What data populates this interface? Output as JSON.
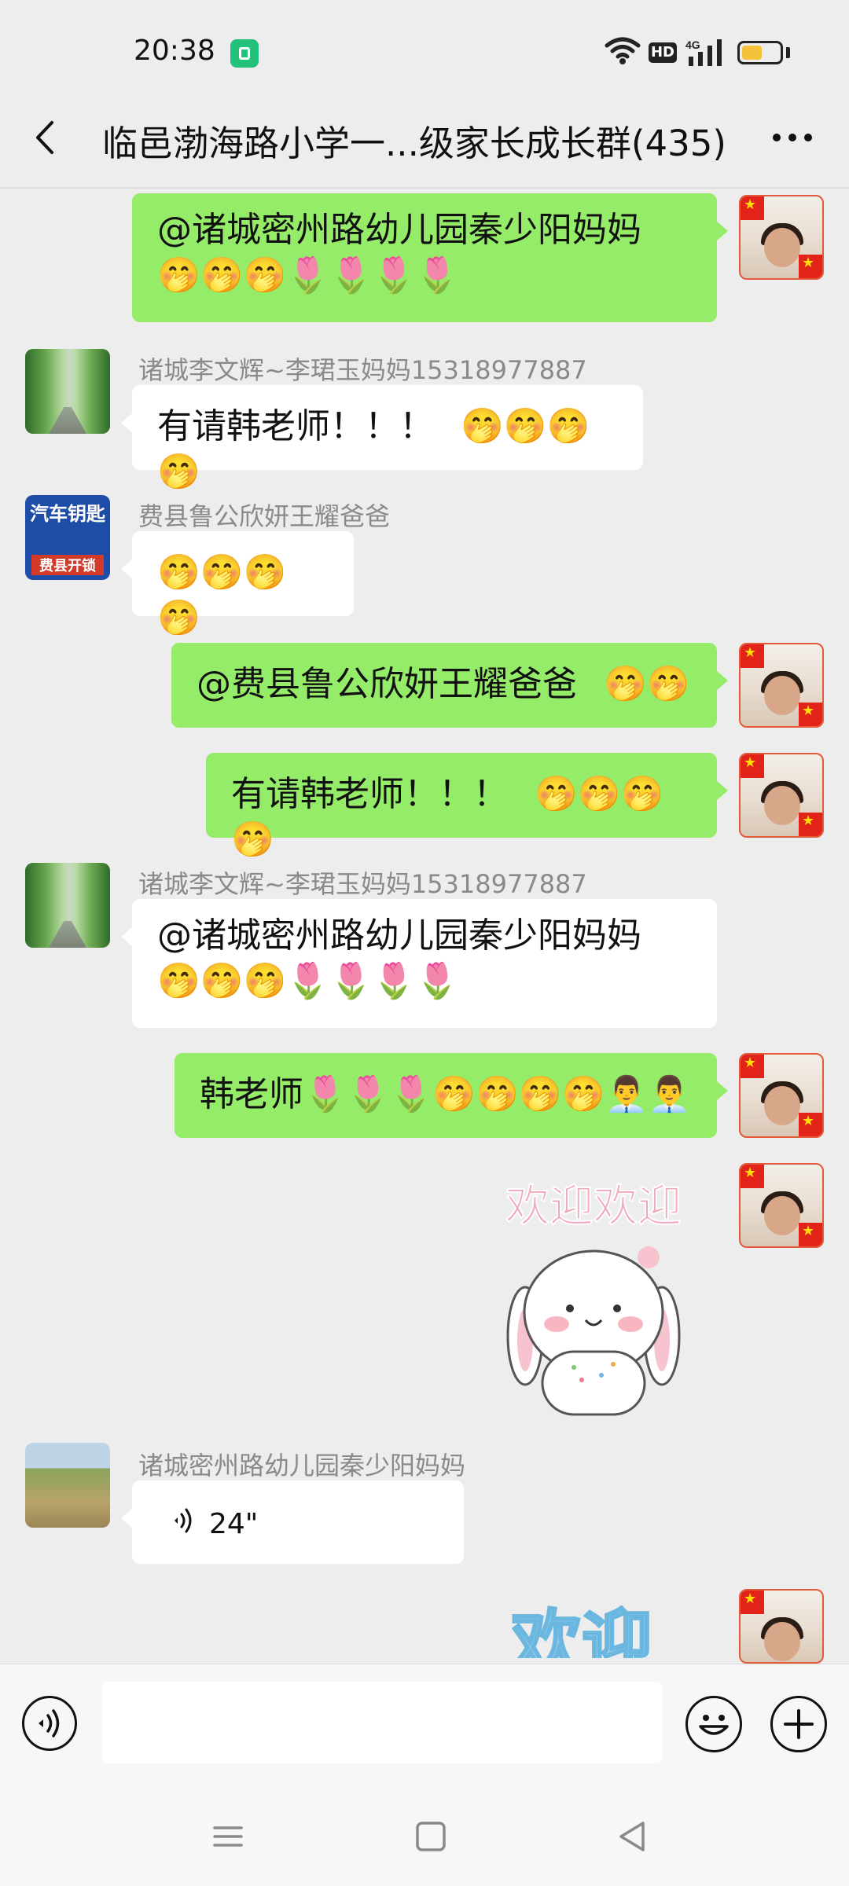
{
  "status_bar": {
    "time": "20:38",
    "hd_label": "HD",
    "network_label": "4G",
    "battery_level": 0.6
  },
  "header": {
    "title": "临邑渤海路小学一...级家长成长群(435)"
  },
  "messages": [
    {
      "side": "out",
      "text": "@诸城密州路幼儿园秦少阳妈妈",
      "emoji_line": "🤭🤭🤭🌷🌷🌷🌷"
    },
    {
      "side": "in",
      "sender": "诸城李文辉~李珺玉妈妈15318977887",
      "text": "有请韩老师！！！",
      "emoji": "🤭🤭🤭🤭"
    },
    {
      "side": "in",
      "sender": "费县鲁公欣妍王耀爸爸",
      "avatar_text": [
        "汽车钥匙",
        "费县开锁"
      ],
      "emoji": "🤭🤭🤭🤭"
    },
    {
      "side": "out",
      "text": "@费县鲁公欣妍王耀爸爸",
      "emoji": "🤭🤭"
    },
    {
      "side": "out",
      "text": "有请韩老师！！！",
      "emoji": "🤭🤭🤭🤭"
    },
    {
      "side": "in",
      "sender": "诸城李文辉~李珺玉妈妈15318977887",
      "text": "@诸城密州路幼儿园秦少阳妈妈",
      "emoji_line": "🤭🤭🤭🌷🌷🌷🌷"
    },
    {
      "side": "out",
      "text": "韩老师",
      "emoji": "🌷🌷🌷🤭🤭🤭🤭👨‍💼👨‍💼"
    },
    {
      "side": "out",
      "type": "sticker",
      "sticker_text": "欢迎欢迎"
    },
    {
      "side": "in",
      "sender": "诸城密州路幼儿园秦少阳妈妈",
      "type": "voice",
      "duration": "24\""
    },
    {
      "side": "out",
      "type": "sticker",
      "sticker_text": "欢迎"
    }
  ],
  "input": {
    "placeholder": ""
  },
  "colors": {
    "out_bubble": "#95EC69",
    "in_bubble": "#FFFFFF",
    "background": "#EDEDED",
    "accent_red": "#E2231A"
  },
  "icons": {
    "back": "chevron-left-icon",
    "more": "more-icon",
    "voice": "voice-input-icon",
    "emoji": "emoji-icon",
    "plus": "plus-icon",
    "nav_menu": "menu-icon",
    "nav_home": "home-icon",
    "nav_back": "back-triangle-icon"
  }
}
